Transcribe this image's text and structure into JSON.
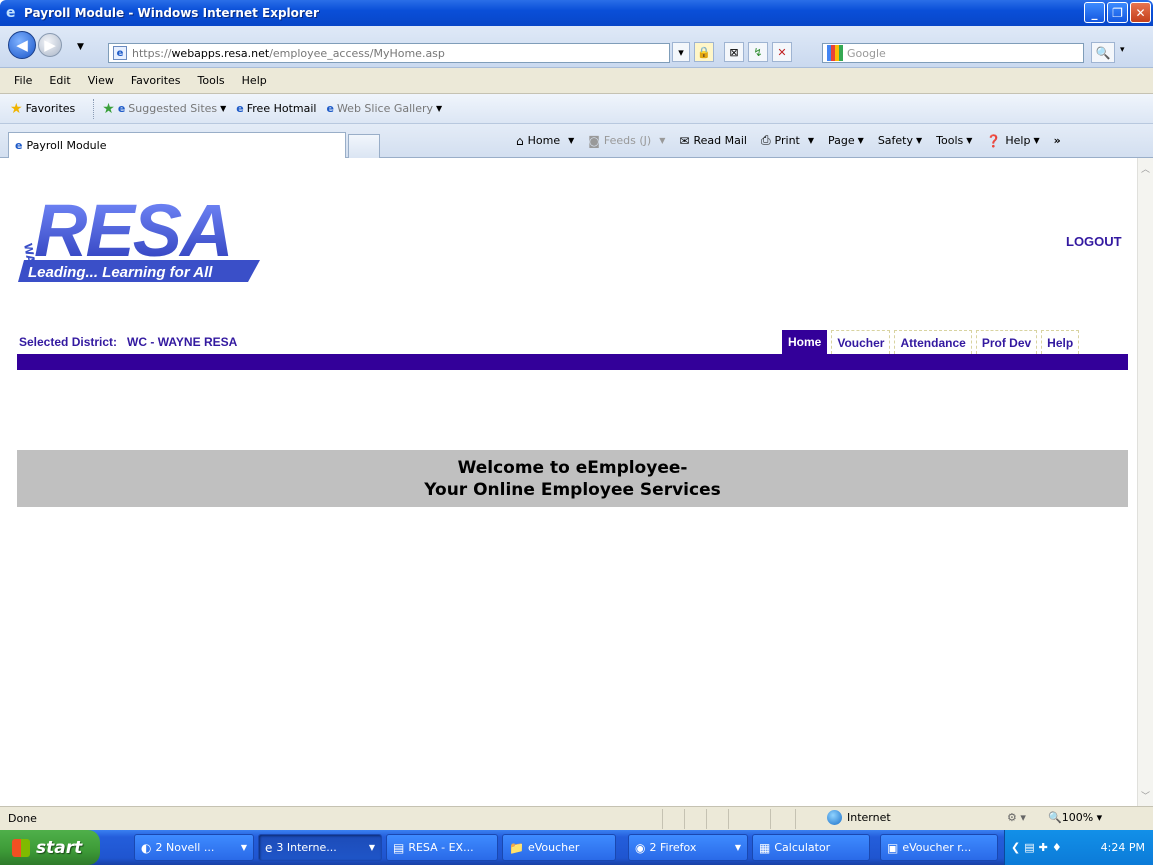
{
  "window": {
    "title": "Payroll Module - Windows Internet Explorer"
  },
  "address": {
    "url_prefix": "https://",
    "url_host": "webapps.resa.net",
    "url_path": "/employee_access/MyHome.asp"
  },
  "search": {
    "placeholder": "Google"
  },
  "menu": [
    "File",
    "Edit",
    "View",
    "Favorites",
    "Tools",
    "Help"
  ],
  "favorites": {
    "label": "Favorites",
    "suggested": "Suggested Sites",
    "hotmail": "Free Hotmail",
    "webslice": "Web Slice Gallery"
  },
  "tab": {
    "title": "Payroll Module"
  },
  "commands": {
    "home": "Home",
    "feeds": "Feeds (J)",
    "readmail": "Read Mail",
    "print": "Print",
    "page": "Page",
    "safety": "Safety",
    "tools": "Tools",
    "help": "Help"
  },
  "site": {
    "logo_brand": "RESA",
    "logo_side": "WAYNE",
    "logo_tagline": "Leading... Learning for All",
    "logout": "LOGOUT",
    "district_label": "Selected District:",
    "district_value": "WC - WAYNE RESA",
    "nav": [
      "Home",
      "Voucher",
      "Attendance",
      "Prof Dev",
      "Help"
    ],
    "nav_active": "Home",
    "welcome_line1": "Welcome to eEmployee-",
    "welcome_line2": "Your Online Employee Services"
  },
  "status": {
    "text": "Done",
    "zone": "Internet",
    "zoom": "100%"
  },
  "taskbar": {
    "start": "start",
    "items": [
      "2 Novell ...",
      "3 Interne...",
      "RESA - EX...",
      "eVoucher",
      "2 Firefox",
      "Calculator",
      "eVoucher r..."
    ],
    "clock": "4:24 PM"
  },
  "colors": {
    "brand_purple": "#330099",
    "welcome_band": "#c0c0c0",
    "logo_blue": "#3a4fc8"
  }
}
